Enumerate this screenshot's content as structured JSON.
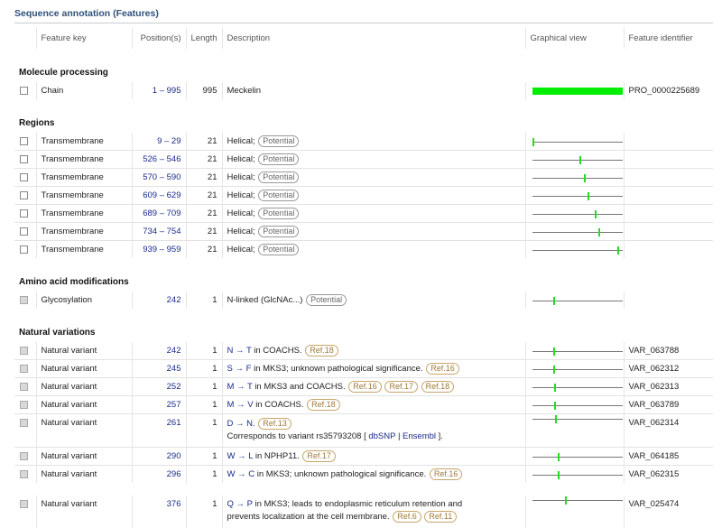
{
  "section": {
    "title": "Sequence annotation (Features)"
  },
  "columns": {
    "feature_key": "Feature key",
    "positions": "Position(s)",
    "length": "Length",
    "description": "Description",
    "graphical_view": "Graphical view",
    "feature_identifier": "Feature identifier"
  },
  "sequence_length": 995,
  "groups": {
    "molecule_processing": {
      "title": "Molecule processing",
      "rows": [
        {
          "key": "Chain",
          "pos": "1 – 995",
          "start": 1,
          "end": 995,
          "len": "995",
          "desc": "Meckelin",
          "id": "PRO_0000225689"
        }
      ]
    },
    "regions": {
      "title": "Regions",
      "rows": [
        {
          "key": "Transmembrane",
          "pos": "9 – 29",
          "start": 9,
          "end": 29,
          "len": "21",
          "desc": "Helical;",
          "pill": "Potential",
          "id": ""
        },
        {
          "key": "Transmembrane",
          "pos": "526 – 546",
          "start": 526,
          "end": 546,
          "len": "21",
          "desc": "Helical;",
          "pill": "Potential",
          "id": ""
        },
        {
          "key": "Transmembrane",
          "pos": "570 – 590",
          "start": 570,
          "end": 590,
          "len": "21",
          "desc": "Helical;",
          "pill": "Potential",
          "id": ""
        },
        {
          "key": "Transmembrane",
          "pos": "609 – 629",
          "start": 609,
          "end": 629,
          "len": "21",
          "desc": "Helical;",
          "pill": "Potential",
          "id": ""
        },
        {
          "key": "Transmembrane",
          "pos": "689 – 709",
          "start": 689,
          "end": 709,
          "len": "21",
          "desc": "Helical;",
          "pill": "Potential",
          "id": ""
        },
        {
          "key": "Transmembrane",
          "pos": "734 – 754",
          "start": 734,
          "end": 754,
          "len": "21",
          "desc": "Helical;",
          "pill": "Potential",
          "id": ""
        },
        {
          "key": "Transmembrane",
          "pos": "939 – 959",
          "start": 939,
          "end": 959,
          "len": "21",
          "desc": "Helical;",
          "pill": "Potential",
          "id": ""
        }
      ]
    },
    "amino_acid_modifications": {
      "title": "Amino acid modifications",
      "rows": [
        {
          "key": "Glycosylation",
          "pos": "242",
          "start": 242,
          "end": 242,
          "len": "1",
          "desc": "N-linked (GlcNAc...)",
          "pill": "Potential",
          "id": ""
        }
      ]
    },
    "natural_variations": {
      "title": "Natural variations",
      "rows": [
        {
          "key": "Natural variant",
          "pos": "242",
          "start": 242,
          "end": 242,
          "len": "1",
          "from": "N",
          "arrow": "→",
          "to": "T",
          "text": "in COACHS.",
          "refs": [
            "Ref.18"
          ],
          "id": "VAR_063788"
        },
        {
          "key": "Natural variant",
          "pos": "245",
          "start": 245,
          "end": 245,
          "len": "1",
          "from": "S",
          "arrow": "→",
          "to": "F",
          "text": "in MKS3; unknown pathological significance.",
          "refs": [
            "Ref.16"
          ],
          "id": "VAR_062312"
        },
        {
          "key": "Natural variant",
          "pos": "252",
          "start": 252,
          "end": 252,
          "len": "1",
          "from": "M",
          "arrow": "→",
          "to": "T",
          "text": "in MKS3 and COACHS.",
          "refs": [
            "Ref.16",
            "Ref.17",
            "Ref.18"
          ],
          "id": "VAR_062313"
        },
        {
          "key": "Natural variant",
          "pos": "257",
          "start": 257,
          "end": 257,
          "len": "1",
          "from": "M",
          "arrow": "→",
          "to": "V",
          "text": "in COACHS.",
          "refs": [
            "Ref.18"
          ],
          "id": "VAR_063789"
        },
        {
          "key": "Natural variant",
          "pos": "261",
          "start": 261,
          "end": 261,
          "len": "1",
          "from": "D",
          "arrow": "→",
          "to": "N.",
          "text": "",
          "refs": [
            "Ref.13"
          ],
          "line2_prefix": "Corresponds to variant rs35793208 [",
          "link1": "dbSNP",
          "sep": "|",
          "link2": "Ensembl",
          "line2_suffix": "].",
          "id": "VAR_062314"
        },
        {
          "key": "Natural variant",
          "pos": "290",
          "start": 290,
          "end": 290,
          "len": "1",
          "from": "W",
          "arrow": "→",
          "to": "L",
          "text": "in NPHP11.",
          "refs": [
            "Ref.17"
          ],
          "id": "VAR_064185"
        },
        {
          "key": "Natural variant",
          "pos": "296",
          "start": 296,
          "end": 296,
          "len": "1",
          "from": "W",
          "arrow": "→",
          "to": "C",
          "text": "in MKS3; unknown pathological significance.",
          "refs": [
            "Ref.16"
          ],
          "id": "VAR_062315"
        },
        {
          "key": "Natural variant",
          "pos": "376",
          "start": 376,
          "end": 376,
          "len": "1",
          "from": "Q",
          "arrow": "→",
          "to": "P",
          "text": "in MKS3; leads to endoplasmic reticulum retention and",
          "line2_text": "prevents localization at the cell membrane.",
          "refs": [
            "Ref.6",
            "Ref.11"
          ],
          "id": "VAR_025474"
        }
      ]
    }
  },
  "colors": {
    "feature_bar": "#00ee00",
    "link": "#1a2a8a",
    "ref_border": "#c8a56a",
    "section_title": "#31507a"
  }
}
